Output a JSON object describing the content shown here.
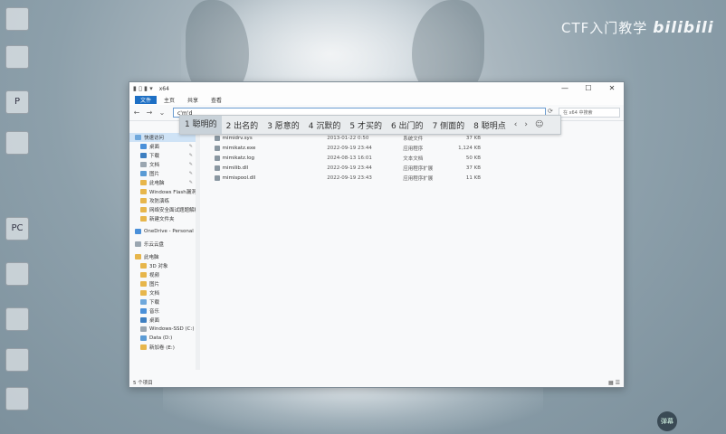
{
  "watermark": {
    "text": "CTF入门教学",
    "brand": "bilibili"
  },
  "desktop_icons": [
    "",
    "",
    "P",
    "",
    "PC",
    "",
    "",
    "",
    ""
  ],
  "badge": "弹幕",
  "explorer": {
    "title": "x64",
    "window_controls": [
      "—",
      "☐",
      "✕"
    ],
    "ribbon_tabs": [
      "文件",
      "主页",
      "共享",
      "查看"
    ],
    "address_value": "c'm'd",
    "search_placeholder": "在 x64 中搜索",
    "ime": {
      "candidates": [
        "1 聪明的",
        "2 出名的",
        "3 愿意的",
        "4 沉默的",
        "5 才买的",
        "6 出门的",
        "7 侧面的",
        "8 聪明点"
      ],
      "controls": [
        "‹",
        "›",
        "☺"
      ]
    },
    "sidebar": [
      {
        "label": "快速访问",
        "kind": "head",
        "pin": false
      },
      {
        "label": "桌面",
        "kind": "sub",
        "pin": true
      },
      {
        "label": "下载",
        "kind": "sub",
        "pin": true
      },
      {
        "label": "文档",
        "kind": "sub",
        "pin": true
      },
      {
        "label": "图片",
        "kind": "sub",
        "pin": true
      },
      {
        "label": "此电脑",
        "kind": "sub",
        "pin": true
      },
      {
        "label": "Windows Flash漏洞",
        "kind": "sub",
        "pin": false
      },
      {
        "label": "攻防演练",
        "kind": "sub",
        "pin": false
      },
      {
        "label": "网络安全面试题题解析",
        "kind": "sub",
        "pin": false
      },
      {
        "label": "新建文件夹",
        "kind": "sub",
        "pin": false
      },
      {
        "label": "",
        "kind": "gap",
        "pin": false
      },
      {
        "label": "OneDrive - Personal",
        "kind": "head",
        "pin": false
      },
      {
        "label": "",
        "kind": "gap",
        "pin": false
      },
      {
        "label": "乐云云盘",
        "kind": "head",
        "pin": false
      },
      {
        "label": "",
        "kind": "gap",
        "pin": false
      },
      {
        "label": "此电脑",
        "kind": "head",
        "pin": false
      },
      {
        "label": "3D 对象",
        "kind": "sub",
        "pin": false
      },
      {
        "label": "视频",
        "kind": "sub",
        "pin": false
      },
      {
        "label": "图片",
        "kind": "sub",
        "pin": false
      },
      {
        "label": "文档",
        "kind": "sub",
        "pin": false
      },
      {
        "label": "下载",
        "kind": "sub",
        "pin": false
      },
      {
        "label": "音乐",
        "kind": "sub",
        "pin": false
      },
      {
        "label": "桌面",
        "kind": "sub",
        "pin": false
      },
      {
        "label": "Windows-SSD (C:)",
        "kind": "sub",
        "pin": false
      },
      {
        "label": "Data (D:)",
        "kind": "sub",
        "pin": false
      },
      {
        "label": "新加卷 (E:)",
        "kind": "sub",
        "pin": false
      }
    ],
    "files": [
      {
        "name": "mimidrv.sys",
        "date": "2013-01-22 0:50",
        "type": "系统文件",
        "size": "37 KB"
      },
      {
        "name": "mimikatz.exe",
        "date": "2022-09-19 23:44",
        "type": "应用程序",
        "size": "1,124 KB"
      },
      {
        "name": "mimikatz.log",
        "date": "2024-08-13 16:01",
        "type": "文本文档",
        "size": "50 KB"
      },
      {
        "name": "mimilib.dll",
        "date": "2022-09-19 23:44",
        "type": "应用程序扩展",
        "size": "37 KB"
      },
      {
        "name": "mimispool.dll",
        "date": "2022-09-19 23:43",
        "type": "应用程序扩展",
        "size": "11 KB"
      }
    ],
    "status": "5 个项目",
    "view_buttons": "▦ ☰"
  },
  "colors": {
    "accent": "#1d6fc4",
    "selection": "#cfe3f6"
  }
}
